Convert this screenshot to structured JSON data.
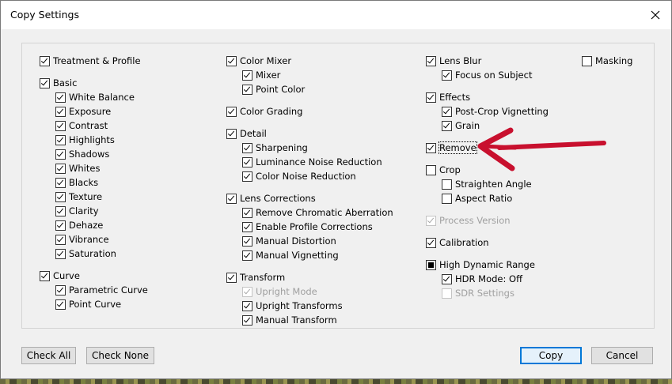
{
  "dialog": {
    "title": "Copy Settings",
    "close_icon": "close-icon"
  },
  "column1": {
    "treatment_profile": {
      "label": "Treatment & Profile",
      "checked": true
    },
    "basic": {
      "label": "Basic",
      "checked": true
    },
    "basic_items": [
      {
        "label": "White Balance",
        "checked": true
      },
      {
        "label": "Exposure",
        "checked": true
      },
      {
        "label": "Contrast",
        "checked": true
      },
      {
        "label": "Highlights",
        "checked": true
      },
      {
        "label": "Shadows",
        "checked": true
      },
      {
        "label": "Whites",
        "checked": true
      },
      {
        "label": "Blacks",
        "checked": true
      },
      {
        "label": "Texture",
        "checked": true
      },
      {
        "label": "Clarity",
        "checked": true
      },
      {
        "label": "Dehaze",
        "checked": true
      },
      {
        "label": "Vibrance",
        "checked": true
      },
      {
        "label": "Saturation",
        "checked": true
      }
    ],
    "curve": {
      "label": "Curve",
      "checked": true
    },
    "curve_items": [
      {
        "label": "Parametric Curve",
        "checked": true
      },
      {
        "label": "Point Curve",
        "checked": true
      }
    ]
  },
  "column2": {
    "color_mixer": {
      "label": "Color Mixer",
      "checked": true
    },
    "color_mixer_items": [
      {
        "label": "Mixer",
        "checked": true
      },
      {
        "label": "Point Color",
        "checked": true
      }
    ],
    "color_grading": {
      "label": "Color Grading",
      "checked": true
    },
    "detail": {
      "label": "Detail",
      "checked": true
    },
    "detail_items": [
      {
        "label": "Sharpening",
        "checked": true
      },
      {
        "label": "Luminance Noise Reduction",
        "checked": true
      },
      {
        "label": "Color Noise Reduction",
        "checked": true
      }
    ],
    "lens_corrections": {
      "label": "Lens Corrections",
      "checked": true
    },
    "lens_corrections_items": [
      {
        "label": "Remove Chromatic Aberration",
        "checked": true
      },
      {
        "label": "Enable Profile Corrections",
        "checked": true
      },
      {
        "label": "Manual Distortion",
        "checked": true
      },
      {
        "label": "Manual Vignetting",
        "checked": true
      }
    ],
    "transform": {
      "label": "Transform",
      "checked": true
    },
    "transform_items": [
      {
        "label": "Upright Mode",
        "checked": true,
        "disabled": true
      },
      {
        "label": "Upright Transforms",
        "checked": true
      },
      {
        "label": "Manual Transform",
        "checked": true
      }
    ]
  },
  "column3": {
    "lens_blur": {
      "label": "Lens Blur",
      "checked": true
    },
    "lens_blur_items": [
      {
        "label": "Focus on Subject",
        "checked": true
      }
    ],
    "effects": {
      "label": "Effects",
      "checked": true
    },
    "effects_items": [
      {
        "label": "Post-Crop Vignetting",
        "checked": true
      },
      {
        "label": "Grain",
        "checked": true
      }
    ],
    "remove": {
      "label": "Remove",
      "checked": true,
      "focused": true
    },
    "crop": {
      "label": "Crop",
      "checked": false
    },
    "crop_items": [
      {
        "label": "Straighten Angle",
        "checked": false
      },
      {
        "label": "Aspect Ratio",
        "checked": false
      }
    ],
    "process_version": {
      "label": "Process Version",
      "checked": true,
      "disabled": true
    },
    "calibration": {
      "label": "Calibration",
      "checked": true
    },
    "hdr": {
      "label": "High Dynamic Range",
      "state": "indeterminate"
    },
    "hdr_items": [
      {
        "label": "HDR Mode: Off",
        "checked": true
      },
      {
        "label": "SDR Settings",
        "checked": false,
        "disabled": true
      }
    ]
  },
  "column4": {
    "masking": {
      "label": "Masking",
      "checked": false
    }
  },
  "buttons": {
    "check_all": "Check All",
    "check_none": "Check None",
    "copy": "Copy",
    "cancel": "Cancel"
  },
  "annotation": {
    "color": "#c8102e",
    "icon": "red-arrow-annotation"
  }
}
